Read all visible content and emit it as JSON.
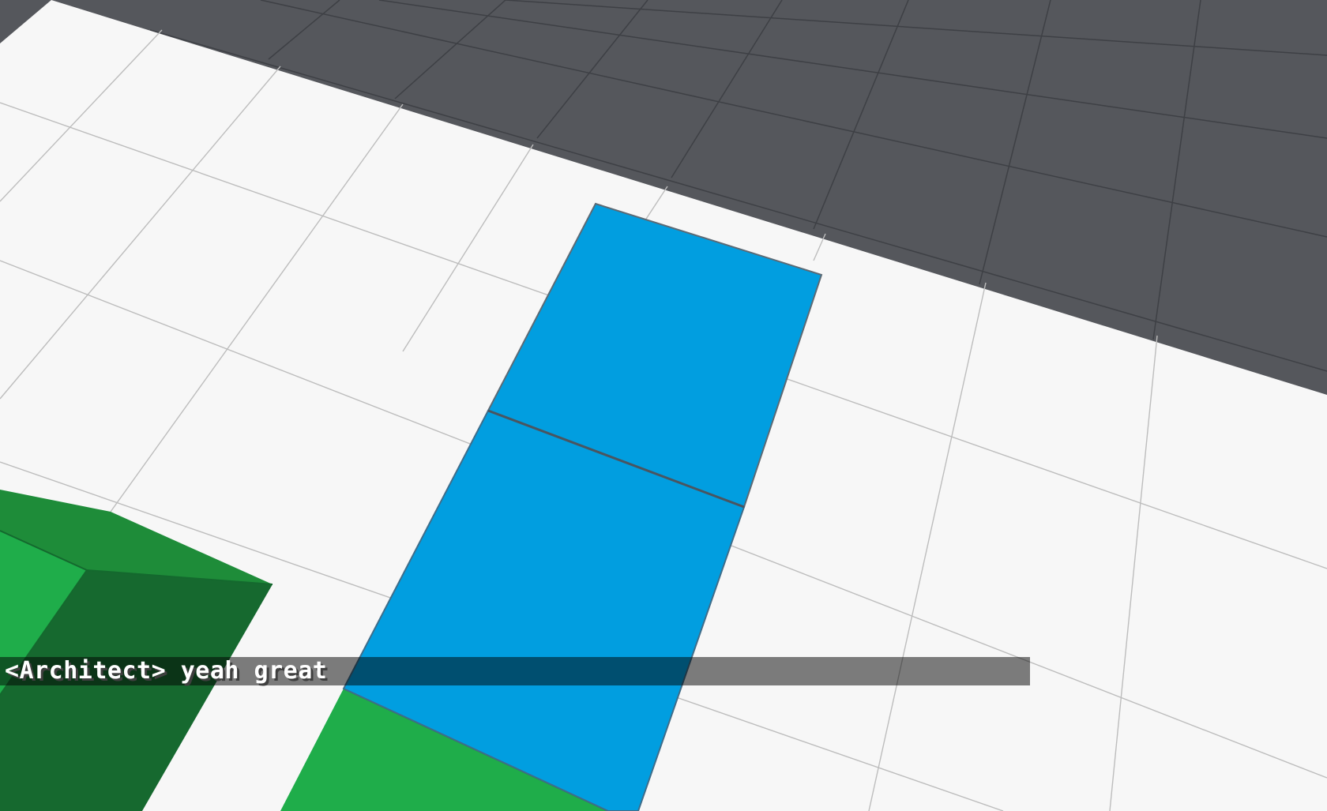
{
  "scene": {
    "void_color": "#55575c",
    "floor_color": "#f7f7f7",
    "block_colors": {
      "blue": "#019ee0",
      "green_top": "#1fad4a",
      "green_side_light": "#1e8c39",
      "green_side_dark": "#16692f"
    }
  },
  "chat": {
    "line": "<Architect> yeah great"
  }
}
